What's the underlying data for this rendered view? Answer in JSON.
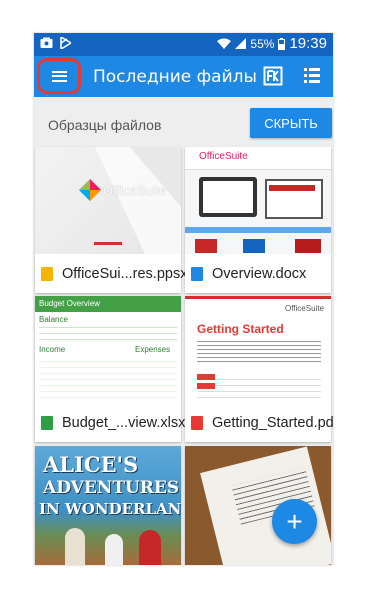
{
  "status_bar": {
    "battery": "55%",
    "time": "19:39"
  },
  "app_bar": {
    "title": "Последние файлы",
    "menu_icon": "hamburger-menu-icon",
    "fk_icon": "file-commander-icon",
    "view_icon": "list-view-icon"
  },
  "section": {
    "title": "Образцы файлов",
    "hide_label": "СКРЫТЬ"
  },
  "thumbs": {
    "officesuite_logo": "OfficeSuite",
    "overview_logo": "OfficeSuite",
    "budget_title": "Budget Overview",
    "budget_balance": "Balance",
    "budget_income": "Income",
    "budget_expenses": "Expenses",
    "gs_title": "Getting Started",
    "gs_logo": "OfficeSuite",
    "alice_line1": "ALICE'S",
    "alice_line2": "ADVENTURES",
    "alice_line3": "IN WONDERLAND"
  },
  "files": [
    {
      "name": "OfficeSui...res.ppsx",
      "type": "ppsx",
      "color": "#f5b400"
    },
    {
      "name": "Overview.docx",
      "type": "docx",
      "color": "#1e88e5"
    },
    {
      "name": "Budget_...view.xlsx",
      "type": "xlsx",
      "color": "#2e9e44"
    },
    {
      "name": "Getting_Started.pdf",
      "type": "pdf",
      "color": "#e53935"
    }
  ],
  "fab": {
    "label": "+"
  }
}
